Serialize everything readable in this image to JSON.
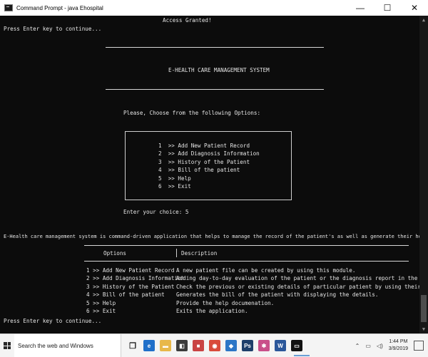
{
  "window": {
    "title": "Command Prompt - java Ehospital",
    "icon": "cmd-icon",
    "minimize": "—",
    "maximize": "☐",
    "close": "✕"
  },
  "console": {
    "access": "Access Granted!",
    "press_enter_top": "Press Enter key to continue...",
    "system_title": "E-HEALTH CARE MANAGEMENT SYSTEM",
    "choose_prompt": "Please, Choose from the following Options:",
    "menu": [
      "1  >> Add New Patient Record",
      "2  >> Add Diagnosis Information",
      "3  >> History of the Patient",
      "4  >> Bill of the patient",
      "5  >> Help",
      "6  >> Exit"
    ],
    "choice_line": "Enter your choice: 5",
    "help_intro": "E-Health care management system is command-driven application that helps to manage the record of the patient's as well as generate their hospital bills.",
    "help_table": {
      "headers": [
        "Options",
        "Description"
      ],
      "rows": [
        [
          "1 >> Add New Patient Record",
          "A new patient file can be created by using this module."
        ],
        [
          "2 >> Add Diagnosis Information",
          "Adding day-to-day evaluation of the patient or the diagnosis report in the existing file."
        ],
        [
          "3 >> History of the Patient",
          "Check the previous or existing details of particular patient by using their file name."
        ],
        [
          "4 >> Bill of the patient",
          "Generates the bill of the patient with displaying the details."
        ],
        [
          "5 >> Help",
          "Provide the help documenation."
        ],
        [
          "6 >> Exit",
          "Exits the application."
        ]
      ]
    },
    "press_enter_bottom": "Press Enter key to continue..."
  },
  "taskbar": {
    "search_placeholder": "Search the web and Windows",
    "apps": [
      {
        "name": "task-view",
        "glyph": "❐",
        "color": "#f4f4f4"
      },
      {
        "name": "edge",
        "glyph": "e",
        "color": "#1f6fc9"
      },
      {
        "name": "file-explorer",
        "glyph": "▬",
        "color": "#e8b84a"
      },
      {
        "name": "store",
        "glyph": "◧",
        "color": "#3b3b3b"
      },
      {
        "name": "app-red",
        "glyph": "■",
        "color": "#c94343"
      },
      {
        "name": "chrome",
        "glyph": "◉",
        "color": "#d94b3b"
      },
      {
        "name": "app-blue",
        "glyph": "◆",
        "color": "#2c76c6"
      },
      {
        "name": "photoshop",
        "glyph": "Ps",
        "color": "#1e3f6a"
      },
      {
        "name": "app-pink",
        "glyph": "✱",
        "color": "#c94f8a"
      },
      {
        "name": "word",
        "glyph": "W",
        "color": "#2b579a"
      },
      {
        "name": "command-prompt",
        "glyph": "▭",
        "color": "#111111"
      }
    ],
    "tray": {
      "time": "1:44 PM",
      "date": "3/9/2019"
    }
  },
  "colors": {
    "console_bg": "#0c0c0c",
    "console_text": "#e6e6e6",
    "taskbar_bg": "#f4f4f4"
  }
}
